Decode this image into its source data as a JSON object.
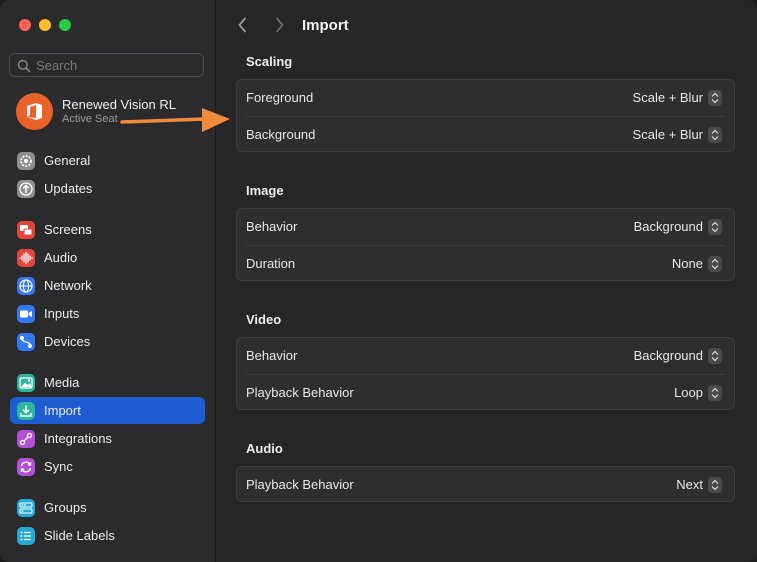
{
  "window": {
    "title": "Import"
  },
  "colors": {
    "accent": "#1f5bd1",
    "annotation_arrow": "#f08a3c",
    "avatar_bg": "#e8622a"
  },
  "sidebar": {
    "search_placeholder": "Search",
    "account": {
      "name": "Renewed Vision RL",
      "subtitle": "Active Seat"
    },
    "items": [
      {
        "label": "General",
        "icon": "gear-icon",
        "color": "#8e8e93"
      },
      {
        "label": "Updates",
        "icon": "update-arrow-icon",
        "color": "#8e8e93"
      },
      {
        "label": "Screens",
        "icon": "screens-icon",
        "color": "#e5443a"
      },
      {
        "label": "Audio",
        "icon": "waveform-icon",
        "color": "#e5443a"
      },
      {
        "label": "Network",
        "icon": "globe-icon",
        "color": "#3478f6"
      },
      {
        "label": "Inputs",
        "icon": "video-input-icon",
        "color": "#3478f6"
      },
      {
        "label": "Devices",
        "icon": "devices-icon",
        "color": "#3478f6"
      },
      {
        "label": "Media",
        "icon": "media-icon",
        "color": "#2fb4a0"
      },
      {
        "label": "Import",
        "icon": "import-icon",
        "color": "#2fb4a0",
        "selected": true
      },
      {
        "label": "Integrations",
        "icon": "integrations-icon",
        "color": "#b44fd8"
      },
      {
        "label": "Sync",
        "icon": "sync-icon",
        "color": "#b44fd8"
      },
      {
        "label": "Groups",
        "icon": "groups-icon",
        "color": "#23a8d8"
      },
      {
        "label": "Slide Labels",
        "icon": "list-icon",
        "color": "#23a8d8"
      }
    ]
  },
  "main": {
    "title": "Import",
    "sections": [
      {
        "title": "Scaling",
        "rows": [
          {
            "label": "Foreground",
            "value": "Scale + Blur"
          },
          {
            "label": "Background",
            "value": "Scale + Blur"
          }
        ]
      },
      {
        "title": "Image",
        "rows": [
          {
            "label": "Behavior",
            "value": "Background"
          },
          {
            "label": "Duration",
            "value": "None"
          }
        ]
      },
      {
        "title": "Video",
        "rows": [
          {
            "label": "Behavior",
            "value": "Background"
          },
          {
            "label": "Playback Behavior",
            "value": "Loop"
          }
        ]
      },
      {
        "title": "Audio",
        "rows": [
          {
            "label": "Playback Behavior",
            "value": "Next"
          }
        ]
      }
    ]
  }
}
